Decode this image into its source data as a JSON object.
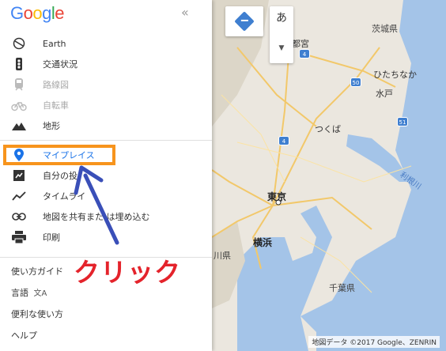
{
  "app": {
    "logo": "Google"
  },
  "menu": {
    "items": [
      {
        "label": "Earth",
        "icon": "earth-icon",
        "state": "normal"
      },
      {
        "label": "交通状況",
        "icon": "traffic-icon",
        "state": "normal"
      },
      {
        "label": "路線図",
        "icon": "transit-icon",
        "state": "disabled"
      },
      {
        "label": "自転車",
        "icon": "bicycle-icon",
        "state": "disabled"
      },
      {
        "label": "地形",
        "icon": "terrain-icon",
        "state": "normal"
      }
    ],
    "items2": [
      {
        "label": "マイプレイス",
        "icon": "pin-icon",
        "state": "highlighted"
      },
      {
        "label": "自分の投",
        "icon": "contribution-icon",
        "state": "normal"
      },
      {
        "label": "タイムライ",
        "icon": "timeline-icon",
        "state": "normal"
      },
      {
        "label": "地図を共有また は埋め込む",
        "icon": "link-icon",
        "state": "normal"
      },
      {
        "label": "印刷",
        "icon": "print-icon",
        "state": "normal"
      }
    ]
  },
  "links": [
    "使い方ガイド",
    "言語",
    "便利な使い方",
    "ヘルプ"
  ],
  "map": {
    "labels": {
      "ibaraki": "茨城県",
      "utsunomiya": "宇都宮",
      "hitachinaka": "ひたちなか",
      "mito": "水戸",
      "tsukuba": "つくば",
      "tokyo": "東京",
      "yokohama": "横浜",
      "chiba": "千葉県",
      "tone": "利根川",
      "kanagawa": "川県"
    },
    "lang_button": "あ",
    "attribution": "地図データ ©2017 Google、ZENRIN"
  },
  "annotation": {
    "text": "クリック"
  },
  "colors": {
    "highlight": "#f7941d",
    "arrow": "#3a4fb8",
    "click": "#e4232b",
    "accent": "#1a73e8"
  }
}
